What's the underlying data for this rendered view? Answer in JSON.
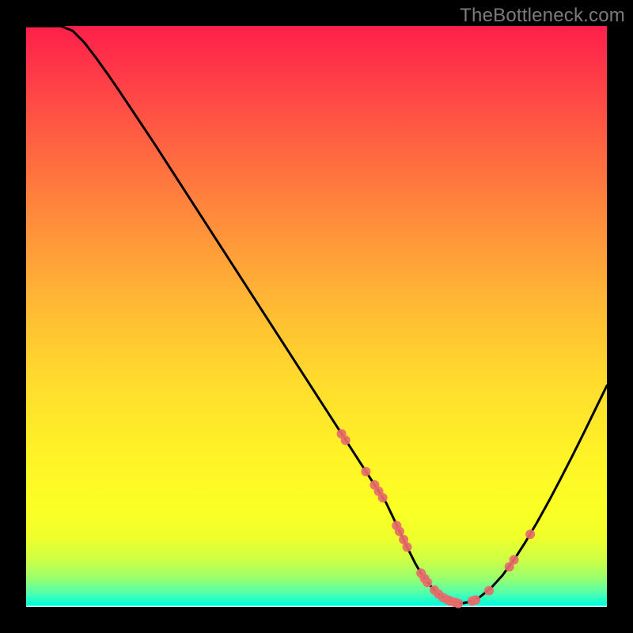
{
  "watermark": "TheBottleneck.com",
  "colors": {
    "curve": "#000000",
    "marker": "#e86a6a",
    "marker_edge": "#9f3a3a"
  },
  "chart_data": {
    "type": "line",
    "title": "",
    "xlabel": "",
    "ylabel": "",
    "xlim": [
      0,
      100
    ],
    "ylim": [
      0,
      100
    ],
    "grid": false,
    "legend": false,
    "series": [
      {
        "name": "curve",
        "x": [
          0,
          2,
          4,
          6,
          8,
          10,
          12,
          14,
          16,
          18,
          20,
          22,
          24,
          26,
          28,
          30,
          32,
          34,
          36,
          38,
          40,
          42,
          44,
          46,
          48,
          50,
          52,
          54,
          56,
          58,
          60,
          62,
          63,
          64,
          65,
          66,
          67,
          68,
          69,
          70,
          71,
          72,
          73,
          74,
          75,
          76,
          78,
          80,
          82,
          84,
          86,
          88,
          90,
          92,
          94,
          96,
          98,
          100
        ],
        "values": [
          100,
          100,
          100,
          100,
          99.2,
          97.2,
          94.6,
          91.8,
          88.9,
          85.9,
          82.9,
          79.9,
          76.8,
          73.7,
          70.6,
          67.5,
          64.4,
          61.3,
          58.2,
          55.1,
          52.0,
          48.9,
          45.8,
          42.7,
          39.6,
          36.5,
          33.4,
          30.3,
          27.2,
          24.1,
          21.0,
          17.9,
          15.8,
          13.7,
          11.6,
          9.5,
          7.5,
          5.8,
          4.4,
          3.2,
          2.2,
          1.5,
          1.0,
          0.7,
          0.6,
          0.8,
          1.6,
          3.2,
          5.4,
          8.1,
          11.2,
          14.6,
          18.2,
          22.0,
          25.9,
          29.9,
          34.0,
          38.1
        ]
      }
    ],
    "markers": [
      {
        "x": 54.3,
        "y": 29.8
      },
      {
        "x": 55.0,
        "y": 28.7
      },
      {
        "x": 58.5,
        "y": 23.3
      },
      {
        "x": 60.0,
        "y": 21.0
      },
      {
        "x": 60.7,
        "y": 19.9
      },
      {
        "x": 61.4,
        "y": 18.8
      },
      {
        "x": 63.8,
        "y": 14.0
      },
      {
        "x": 64.3,
        "y": 13.0
      },
      {
        "x": 65.0,
        "y": 11.6
      },
      {
        "x": 65.6,
        "y": 10.3
      },
      {
        "x": 68.0,
        "y": 5.8
      },
      {
        "x": 68.6,
        "y": 4.9
      },
      {
        "x": 69.1,
        "y": 4.2
      },
      {
        "x": 70.3,
        "y": 2.9
      },
      {
        "x": 71.0,
        "y": 2.2
      },
      {
        "x": 71.8,
        "y": 1.6
      },
      {
        "x": 72.6,
        "y": 1.2
      },
      {
        "x": 73.0,
        "y": 1.0
      },
      {
        "x": 73.8,
        "y": 0.8
      },
      {
        "x": 74.4,
        "y": 0.6
      },
      {
        "x": 76.8,
        "y": 1.0
      },
      {
        "x": 77.4,
        "y": 1.2
      },
      {
        "x": 79.7,
        "y": 2.8
      },
      {
        "x": 83.2,
        "y": 6.9
      },
      {
        "x": 84.0,
        "y": 8.1
      },
      {
        "x": 86.8,
        "y": 12.5
      }
    ],
    "marker_radius_px": 6
  }
}
